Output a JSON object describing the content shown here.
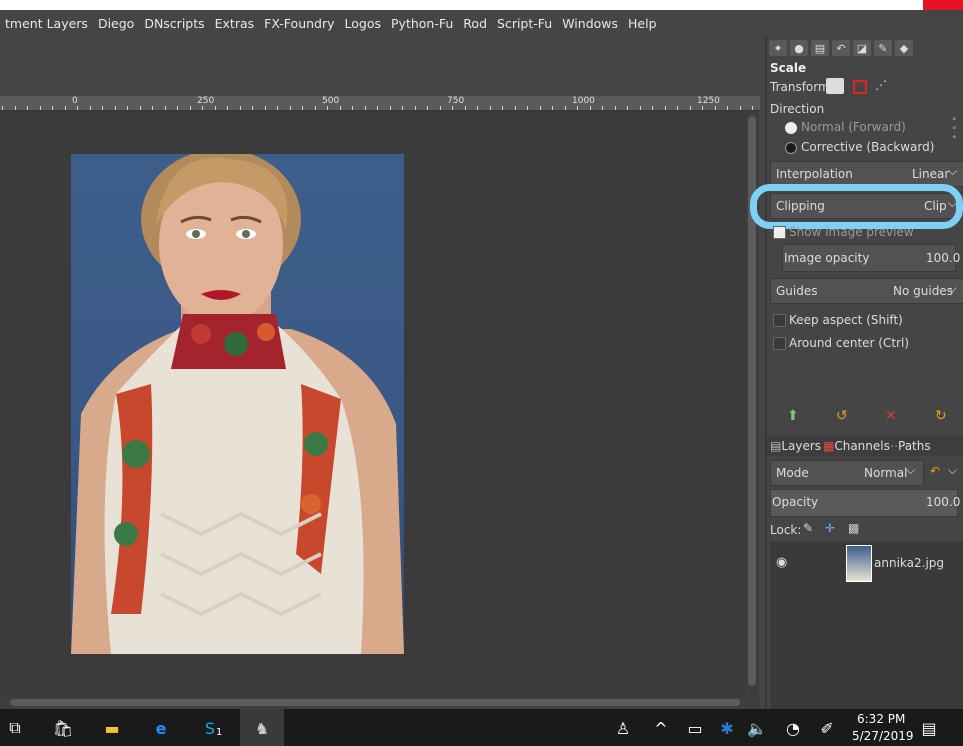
{
  "menu": [
    "tment Layers",
    "Diego",
    "DNscripts",
    "Extras",
    "FX-Foundry",
    "Logos",
    "Python-Fu",
    "Rod",
    "Script-Fu",
    "Windows",
    "Help"
  ],
  "ruler": {
    "labels": [
      "0",
      "250",
      "500",
      "750",
      "1000",
      "1250"
    ]
  },
  "tool_options": {
    "title": "Scale",
    "transform_label": "Transform:",
    "direction_label": "Direction",
    "direction_normal": "Normal (Forward)",
    "direction_corrective": "Corrective (Backward)",
    "interpolation_label": "Interpolation",
    "interpolation_value": "Linear",
    "clipping_label": "Clipping",
    "clipping_value": "Clip",
    "show_preview": "Show image preview",
    "image_opacity_label": "Image opacity",
    "image_opacity_value": "100.0",
    "guides_label": "Guides",
    "guides_value": "No guides",
    "keep_aspect": "Keep aspect (Shift)",
    "around_center": "Around center (Ctrl)"
  },
  "layers_panel": {
    "tabs": [
      "Layers",
      "Channels",
      "Paths"
    ],
    "mode_label": "Mode",
    "mode_value": "Normal",
    "opacity_label": "Opacity",
    "opacity_value": "100.0",
    "lock_label": "Lock:",
    "layer_name": "annika2.jpg"
  },
  "taskbar": {
    "time": "6:32 PM",
    "date": "5/27/2019",
    "skype_badge": "1"
  },
  "colors": {
    "highlight": "#7fd0f7",
    "background": "#454545"
  }
}
